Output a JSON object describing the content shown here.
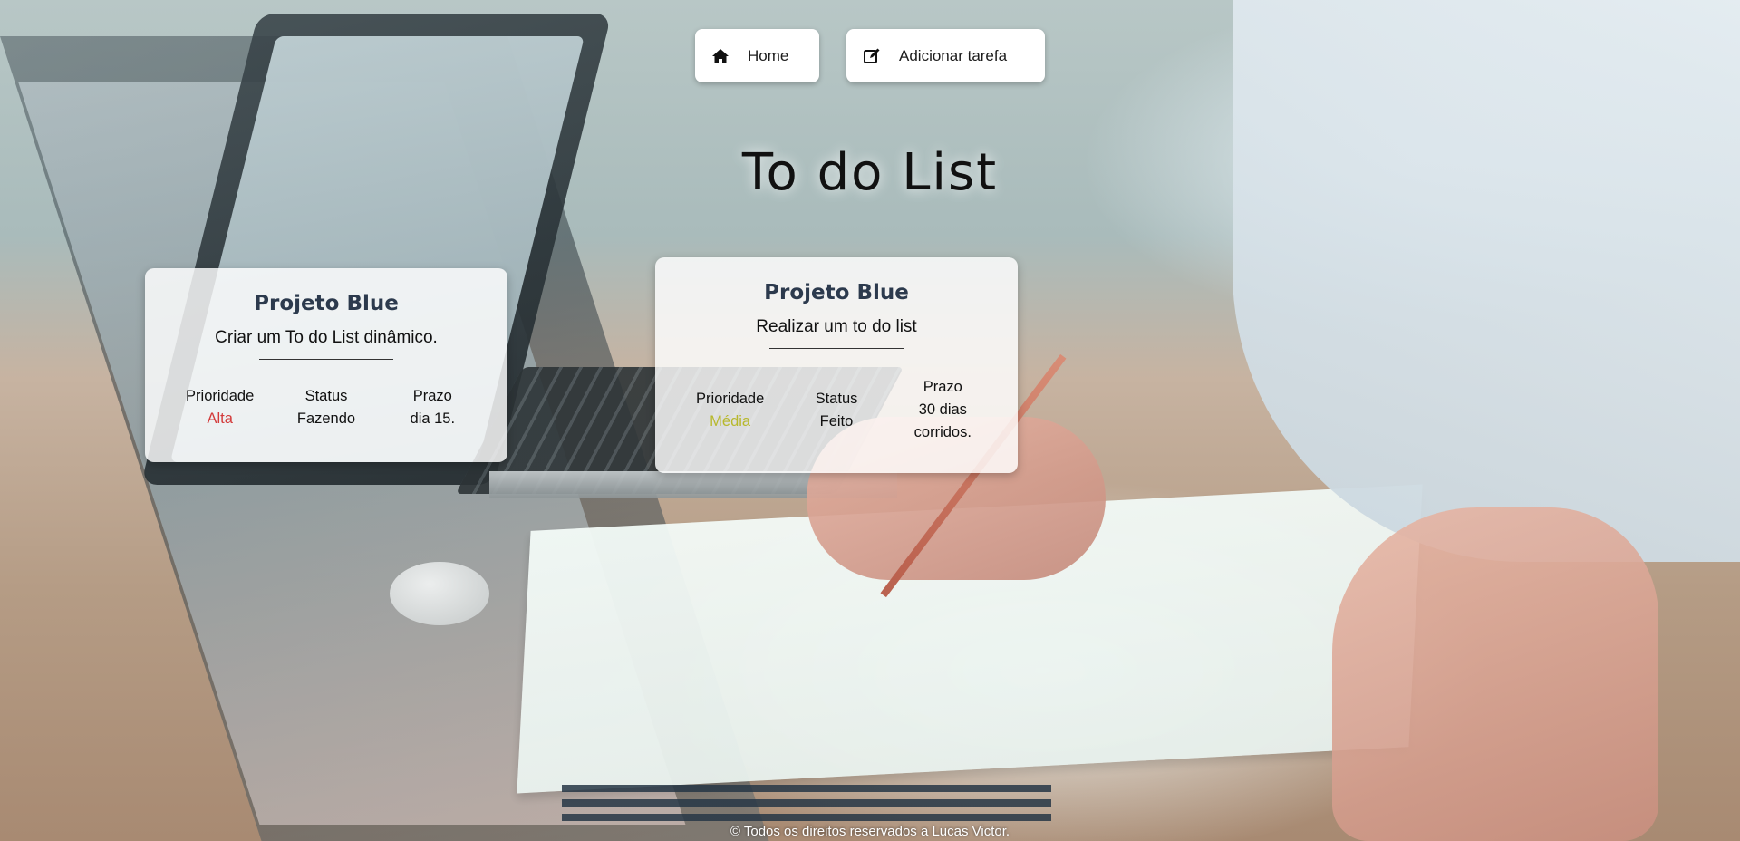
{
  "nav": {
    "home_label": "Home",
    "add_label": "Adicionar tarefa"
  },
  "title": "To do List",
  "tasks": [
    {
      "project": "Projeto Blue",
      "description": "Criar um To do List dinâmico.",
      "priority_label": "Prioridade",
      "priority_value": "Alta",
      "priority_color": "#d33a3a",
      "status_label": "Status",
      "status_value": "Fazendo",
      "deadline_label": "Prazo",
      "deadline_value": "dia 15."
    },
    {
      "project": "Projeto Blue",
      "description": "Realizar um to do list",
      "priority_label": "Prioridade",
      "priority_value": "Média",
      "priority_color": "#b7b82c",
      "status_label": "Status",
      "status_value": "Feito",
      "deadline_label": "Prazo",
      "deadline_value": "30 dias corridos."
    }
  ],
  "footer": "© Todos os direitos reservados a Lucas Victor.",
  "icons": {
    "home": "home-icon",
    "add": "edit-icon"
  }
}
